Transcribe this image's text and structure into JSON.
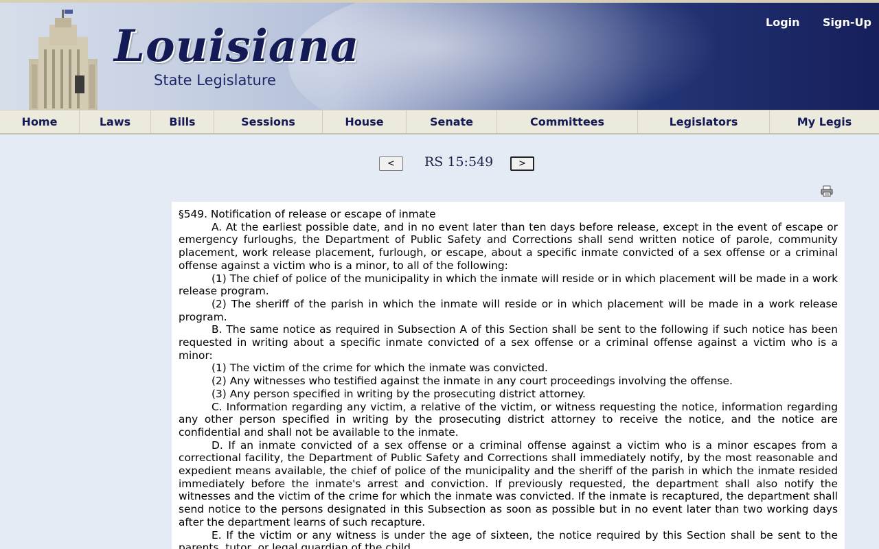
{
  "header": {
    "logo_main": "Louisiana",
    "logo_sub": "State Legislature",
    "login_label": "Login",
    "signup_label": "Sign-Up"
  },
  "nav": {
    "items": [
      {
        "label": "Home"
      },
      {
        "label": "Laws"
      },
      {
        "label": "Bills"
      },
      {
        "label": "Sessions"
      },
      {
        "label": "House"
      },
      {
        "label": "Senate"
      },
      {
        "label": "Committees"
      },
      {
        "label": "Legislators"
      },
      {
        "label": "My Legis"
      }
    ]
  },
  "pager": {
    "prev_label": "<",
    "next_label": ">",
    "title": "RS 15:549"
  },
  "icons": {
    "print": "printer-icon"
  },
  "document": {
    "heading": "§549.  Notification of release or escape of inmate",
    "paragraphs": [
      "A.  At the earliest possible date, and in no event later than ten days before release, except in the event of escape or emergency furloughs, the Department of Public Safety and Corrections shall send written notice of parole, community placement, work release placement, furlough, or escape, about a specific inmate convicted of a sex offense or a criminal offense against a victim who is a minor, to all of the following:",
      "(1)  The chief of police of the municipality in which the inmate will reside or in which placement will be made in a work release program.",
      "(2)  The sheriff of the parish in which the inmate will reside or in which placement will be made in a work release program.",
      "B.  The same notice as required in Subsection A of this Section shall be sent to the following if such notice has been requested in writing about a specific inmate convicted of a sex offense or a criminal offense against a victim who is a minor:",
      "(1)  The victim of the crime for which the inmate was convicted.",
      "(2)  Any witnesses who testified against the inmate in any court proceedings involving the offense.",
      "(3)  Any person specified in writing by the prosecuting district attorney.",
      "C.  Information regarding any victim, a relative of the victim, or witness requesting the notice, information regarding any other person specified in writing by the prosecuting district attorney to receive the notice, and the notice are confidential and shall not be available to the inmate.",
      "D.  If an inmate convicted of a sex offense or a criminal offense against a victim who is a minor escapes from a correctional facility, the Department of Public Safety and Corrections shall immediately notify, by the most reasonable and expedient means available, the chief of police of the municipality and the sheriff of the parish in which the inmate resided immediately before the inmate's arrest and conviction.  If previously requested, the department shall also notify the witnesses and the victim of the crime for which the inmate was convicted.  If the inmate is recaptured, the department shall send notice to the persons designated in this Subsection as soon as possible but in no event later than two working days after the department learns of such recapture.",
      "E.  If the victim or any witness is under the age of sixteen, the notice required by this Section shall be sent to the parents, tutor, or legal guardian of the child."
    ]
  },
  "colors": {
    "nav_text": "#131a55",
    "nav_bg": "#ece9dd",
    "page_bg": "#e4ebf5",
    "header_dark": "#161f5a"
  }
}
